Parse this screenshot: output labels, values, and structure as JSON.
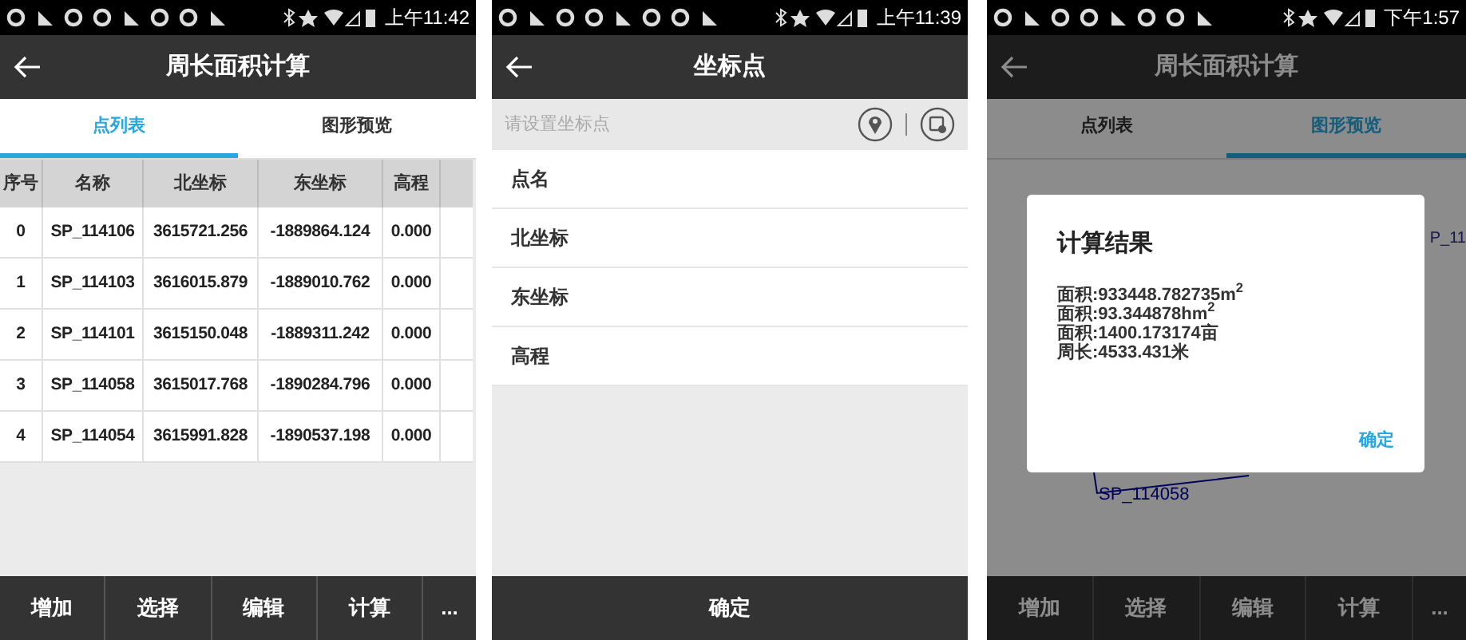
{
  "screens": [
    {
      "kind": "table",
      "status_bar": {
        "time": "上午11:42"
      },
      "title": "周长面积计算",
      "tabs": [
        {
          "label": "点列表",
          "selected": true
        },
        {
          "label": "图形预览",
          "selected": false
        }
      ],
      "table": {
        "columns": [
          "序号",
          "名称",
          "北坐标",
          "东坐标",
          "高程"
        ],
        "rows": [
          [
            "0",
            "SP_114106",
            "3615721.256",
            "-1889864.124",
            "0.000"
          ],
          [
            "1",
            "SP_114103",
            "3616015.879",
            "-1889010.762",
            "0.000"
          ],
          [
            "2",
            "SP_114101",
            "3615150.048",
            "-1889311.242",
            "0.000"
          ],
          [
            "3",
            "SP_114058",
            "3615017.768",
            "-1890284.796",
            "0.000"
          ],
          [
            "4",
            "SP_114054",
            "3615991.828",
            "-1890537.198",
            "0.000"
          ]
        ]
      },
      "toolbar": [
        "增加",
        "选择",
        "编辑",
        "计算",
        "..."
      ]
    },
    {
      "kind": "form",
      "status_bar": {
        "time": "上午11:39"
      },
      "title": "坐标点",
      "search": {
        "placeholder": "请设置坐标点"
      },
      "fields": [
        "点名",
        "北坐标",
        "东坐标",
        "高程"
      ],
      "button": "确定"
    },
    {
      "kind": "preview",
      "status_bar": {
        "time": "下午1:57"
      },
      "title": "周长面积计算",
      "tabs": [
        {
          "label": "点列表",
          "selected": false
        },
        {
          "label": "图形预览",
          "selected": true
        }
      ],
      "drawing_labels": [
        "P_11",
        "SP_114058"
      ],
      "toolbar": [
        "增加",
        "选择",
        "编辑",
        "计算",
        "..."
      ],
      "dialog": {
        "title": "计算结果",
        "lines": [
          "面积:933448.782735m$^{2}$",
          "面积:93.344878hm$^{2}$",
          "面积:1400.173174亩",
          "周长:4533.431米"
        ],
        "button": "确定"
      }
    }
  ]
}
